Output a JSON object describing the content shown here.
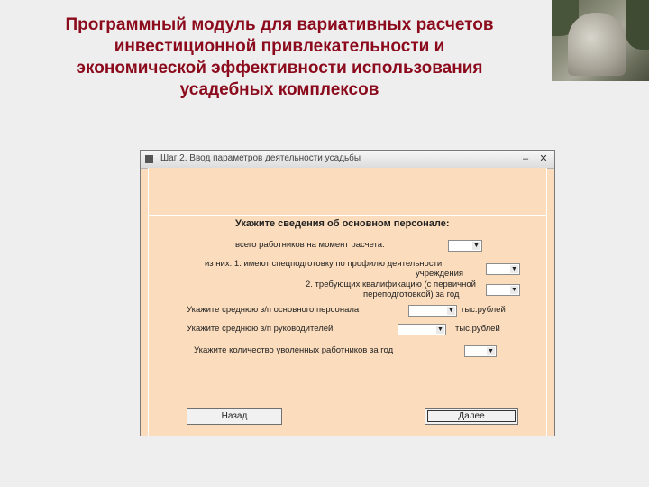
{
  "slide": {
    "title_lines": [
      "Программный модуль для вариативных расчетов",
      "инвестиционной привлекательности и",
      "экономической эффективности использования",
      "усадебных комплексов"
    ]
  },
  "window": {
    "title": "Шаг 2. Ввод параметров деятельности усадьбы",
    "minimize_glyph": "–",
    "close_glyph": "✕"
  },
  "form": {
    "heading": "Укажите сведения об основном персонале:",
    "rows": [
      {
        "label": "всего работников на момент расчета:"
      },
      {
        "label": "из них: 1. имеют спецподготовку по профилю деятельности",
        "label2": "учреждения"
      },
      {
        "label": "2. требующих квалификацию (с первичной",
        "label2": "переподготовкой) за год"
      },
      {
        "label": "Укажите среднюю з/п основного персонала",
        "suffix": "тыс.рублей"
      },
      {
        "label": "Укажите среднюю з/п руководителей",
        "suffix": "тыс.рублей"
      },
      {
        "label": "Укажите количество уволенных работников за год"
      }
    ],
    "combo_arrow": "▼"
  },
  "buttons": {
    "back": "Назад",
    "next": "Далее"
  }
}
